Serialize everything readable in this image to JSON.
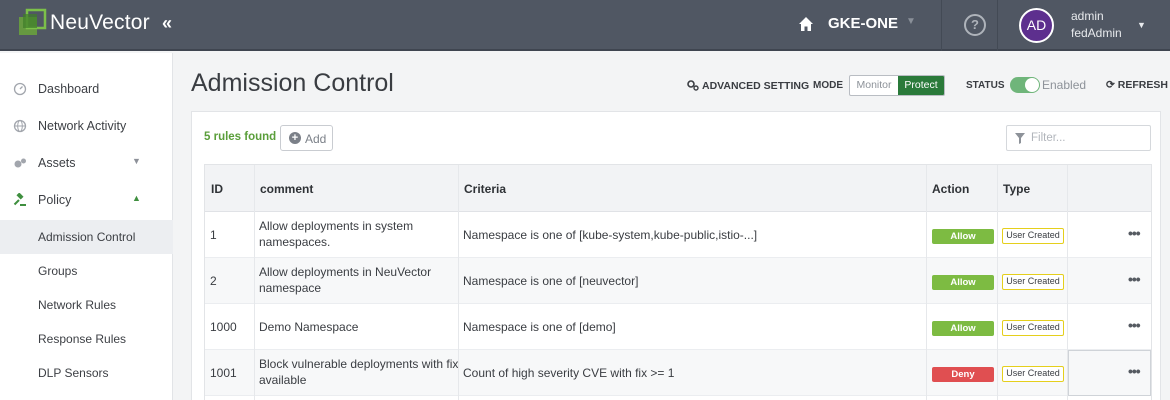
{
  "header": {
    "brand": "NeuVector",
    "collapse_icon": "chevron-double-left-icon",
    "cluster_name": "GKE-ONE",
    "help_glyph": "?",
    "user": {
      "initials": "AD",
      "name": "admin",
      "role": "fedAdmin"
    }
  },
  "sidebar": {
    "items": [
      {
        "label": "Dashboard",
        "icon": "dashboard-icon"
      },
      {
        "label": "Network Activity",
        "icon": "globe-icon"
      },
      {
        "label": "Assets",
        "icon": "assets-icon"
      },
      {
        "label": "Policy",
        "icon": "gavel-icon"
      }
    ],
    "policy_sub": [
      {
        "label": "Admission Control",
        "active": true
      },
      {
        "label": "Groups"
      },
      {
        "label": "Network Rules"
      },
      {
        "label": "Response Rules"
      },
      {
        "label": "DLP Sensors"
      }
    ]
  },
  "page": {
    "title": "Admission Control",
    "advanced_setting": "ADVANCED SETTING",
    "mode_label": "MODE",
    "mode_options": [
      "Monitor",
      "Protect"
    ],
    "mode_selected": "Protect",
    "status_label": "STATUS",
    "status_value": "Enabled",
    "refresh": "REFRESH"
  },
  "panel": {
    "rules_found": "5 rules found",
    "add_label": "Add",
    "add_glyph": "+",
    "filter_placeholder": "Filter..."
  },
  "table": {
    "columns": [
      "ID",
      "comment",
      "Criteria",
      "Action",
      "Type"
    ],
    "rows": [
      {
        "id": "1",
        "comment": "Allow deployments in system namespaces.",
        "criteria": "Namespace is one of [kube-system,kube-public,istio-...]",
        "action": "Allow",
        "type": "User Created"
      },
      {
        "id": "2",
        "comment": "Allow deployments in NeuVector namespace",
        "criteria": "Namespace is one of [neuvector]",
        "action": "Allow",
        "type": "User Created"
      },
      {
        "id": "1000",
        "comment": "Demo Namespace",
        "criteria": "Namespace is one of [demo]",
        "action": "Allow",
        "type": "User Created"
      },
      {
        "id": "1001",
        "comment": "Block vulnerable deployments with fix available",
        "criteria": "Count of high severity CVE with fix >= 1",
        "action": "Deny",
        "type": "User Created"
      }
    ],
    "more_glyph": "•••"
  },
  "colors": {
    "topbar": "#505763",
    "allow": "#7dbb42",
    "deny": "#e04f51",
    "protect": "#2a7a3a",
    "type_border": "#e5cf1c",
    "avatar": "#5d2f8e"
  }
}
